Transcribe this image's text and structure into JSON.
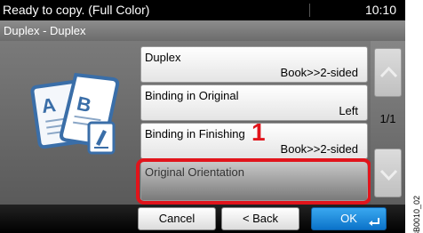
{
  "status": {
    "message": "Ready to copy. (Full Color)",
    "time": "10:10"
  },
  "breadcrumb": "Duplex - Duplex",
  "rows": [
    {
      "title": "Duplex",
      "value": "Book>>2-sided"
    },
    {
      "title": "Binding in Original",
      "value": "Left"
    },
    {
      "title": "Binding in Finishing",
      "value": "Book>>2-sided"
    },
    {
      "title": "Original Orientation",
      "value": ""
    }
  ],
  "callout": "1",
  "page_indicator": "1/1",
  "buttons": {
    "cancel": "Cancel",
    "back": "< Back",
    "ok": "OK"
  },
  "side_code": "3B0010_02",
  "colors": {
    "highlight": "#e1141b",
    "ok": "#1a8ee0"
  }
}
